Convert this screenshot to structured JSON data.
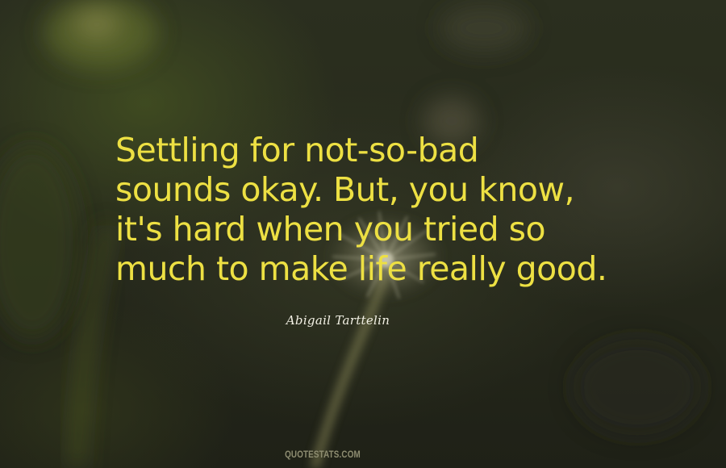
{
  "quote": {
    "lines": [
      "Settling for not-so-bad",
      "sounds okay. But, you know,",
      "it's hard when you tried so",
      "much to make life really good."
    ]
  },
  "author": "Abigail Tarttelin",
  "watermark": "QUOTESTATS.COM",
  "colors": {
    "quote_text": "#ede043",
    "author_text": "#f2f0e4",
    "background": "#272a1c",
    "watermark_text": "#8f8e72"
  },
  "background_image": "blurred-dandelion-photo"
}
